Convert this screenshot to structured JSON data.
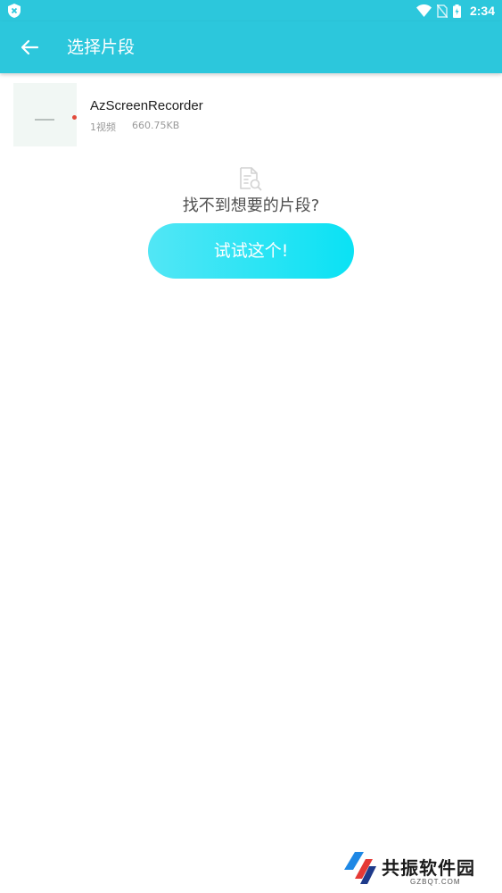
{
  "status_bar": {
    "time": "2:34",
    "icons": [
      "shield-icon",
      "wifi-icon",
      "no-sim-icon",
      "battery-icon"
    ]
  },
  "app_bar": {
    "back_icon": "back-arrow-icon",
    "title": "选择片段"
  },
  "folders": [
    {
      "name": "AzScreenRecorder",
      "count": "1视频",
      "size": "660.75KB"
    }
  ],
  "empty_state": {
    "icon": "document-search-icon",
    "text": "找不到想要的片段?",
    "button_label": "试试这个!"
  },
  "watermark": {
    "name": "共振软件园",
    "url": "GZBQT.COM"
  },
  "colors": {
    "primary": "#2cc7dc",
    "button_start": "#52e6f5",
    "button_end": "#0ae2f4"
  }
}
